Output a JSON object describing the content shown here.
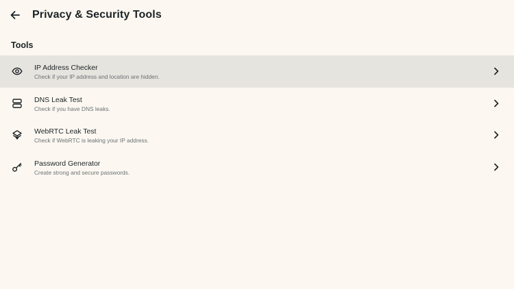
{
  "header": {
    "title": "Privacy & Security Tools",
    "back_icon": "arrow-left-icon"
  },
  "section": {
    "label": "Tools"
  },
  "tools": [
    {
      "title": "IP Address Checker",
      "subtitle": "Check if your IP address and location are hidden.",
      "icon": "eye-icon",
      "selected": true
    },
    {
      "title": "DNS Leak Test",
      "subtitle": "Check if you have DNS leaks.",
      "icon": "server-icon",
      "selected": false
    },
    {
      "title": "WebRTC Leak Test",
      "subtitle": "Check if WebRTC is leaking your IP address.",
      "icon": "layers-icon",
      "selected": false
    },
    {
      "title": "Password Generator",
      "subtitle": "Create strong and secure passwords.",
      "icon": "key-icon",
      "selected": false
    }
  ],
  "colors": {
    "background": "#fcf8f1",
    "selected_row": "#e6e4de",
    "text_primary": "#1c2226",
    "text_secondary": "#6b7074"
  }
}
